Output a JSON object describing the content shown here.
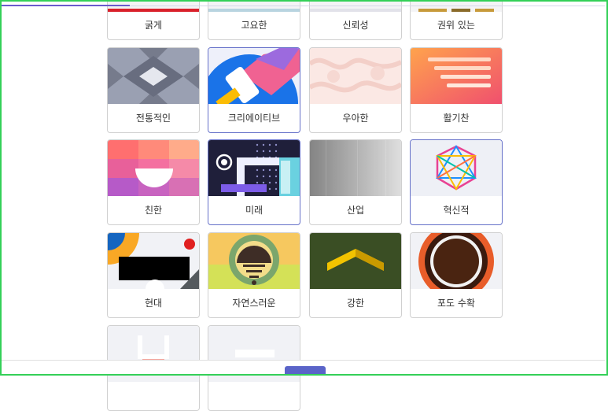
{
  "tiles": {
    "bold": "굵게",
    "calm": "고요한",
    "trustworthy": "신뢰성",
    "authoritative": "권위 있는",
    "traditional": "전통적인",
    "creative": "크리에이티브",
    "elegant": "우아한",
    "energetic": "활기찬",
    "friendly": "친한",
    "future": "미래",
    "industrial": "산업",
    "innovative": "혁신적",
    "modern": "현대",
    "natural": "자연스러운",
    "strong": "강한",
    "vineyard": "포도 수확"
  },
  "colors": {
    "accent": "#5a64c8",
    "selected_border": "#6671c9",
    "frame": "#34d058"
  }
}
